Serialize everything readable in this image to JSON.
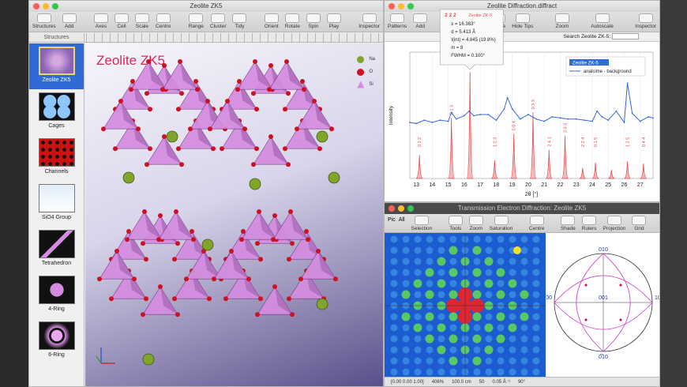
{
  "structure_window": {
    "title": "Zeolite ZK5",
    "toolbar": [
      "Structures",
      "Add",
      "Axes",
      "Cell",
      "Scale",
      "Centre",
      "Range",
      "Cluster",
      "Tidy",
      "Orient",
      "Rotate",
      "Spin",
      "Play",
      "Inspector"
    ],
    "panel_label": "Structures",
    "sidebar": [
      "Zeolite ZK5",
      "Cages",
      "Channels",
      "SiO4 Group",
      "Tetrahedron",
      "4-Ring",
      "6-Ring"
    ],
    "canvas_title": "Zeolite ZK5",
    "legend": [
      {
        "label": "Na",
        "color": "#7fa52a"
      },
      {
        "label": "O",
        "color": "#cc1122"
      },
      {
        "label": "Si",
        "color": "#d58ce0"
      }
    ]
  },
  "diffraction_window": {
    "title": "Zeolite Diffraction.diffract",
    "toolbar": [
      "Patterns",
      "Add",
      "Cursor",
      "Ruler",
      "Loupe",
      "Hide Tips",
      "Zoom",
      "Autoscale",
      "Inspector"
    ],
    "search_label": "Search Zeolite ZK-5:",
    "tooltip": {
      "hkl": "2 2 2",
      "name": "Zeolite ZK-5",
      "lines": [
        "x = 16.363°",
        "d = 5.413 Å",
        "I(int) = 4.845 (19.8%)",
        "m = 8",
        "FWHM = 0.100°"
      ]
    }
  },
  "tem_window": {
    "title": "Transmission Electron Diffraction: Zeolite ZK5",
    "tabs": [
      "Pic",
      "All"
    ],
    "toolbar": [
      "Selection",
      "Tools",
      "Zoom",
      "Saturation",
      "Centre",
      "Shade",
      "Rulers",
      "Projection",
      "Grid"
    ],
    "status": [
      "[0.00 0.00 1.00]",
      "406%",
      "100.0 cm",
      "50",
      "0.05 Å⁻¹",
      "90°"
    ],
    "stereo_labels": [
      "010",
      "0̅10",
      "1̅00",
      "100",
      "001"
    ]
  },
  "chart_data": {
    "type": "line",
    "title": "",
    "xlabel": "2θ [°]",
    "ylabel": "Intensity",
    "xlim": [
      12.6,
      27.8
    ],
    "x_ticks": [
      13,
      14,
      15,
      16,
      17,
      18,
      19,
      20,
      21,
      22,
      23,
      24,
      25,
      26,
      27
    ],
    "series": [
      {
        "name": "Zeolite ZK-5",
        "color": "#e34a4a",
        "type": "peaks",
        "peaks": [
          {
            "x": 13.2,
            "h": 0.22,
            "label": "0 2 2"
          },
          {
            "x": 15.2,
            "h": 0.57,
            "label": "0 1 3"
          },
          {
            "x": 16.36,
            "h": 1.0,
            "label": "2 2 2"
          },
          {
            "x": 17.9,
            "h": 0.17,
            "label": "1 2 3"
          },
          {
            "x": 19.1,
            "h": 0.42,
            "label": "0 0 4"
          },
          {
            "x": 20.3,
            "h": 0.62,
            "label": "0 3 3"
          },
          {
            "x": 21.3,
            "h": 0.27,
            "label": "2 4 1"
          },
          {
            "x": 22.3,
            "h": 0.4,
            "label": "2 3 3"
          },
          {
            "x": 23.4,
            "h": 0.1,
            "label": "2 2 4"
          },
          {
            "x": 24.2,
            "h": 0.15,
            "label": "0 1 5"
          },
          {
            "x": 25.2,
            "h": 0.08,
            "label": ""
          },
          {
            "x": 26.2,
            "h": 0.16,
            "label": "1 2 5"
          },
          {
            "x": 27.2,
            "h": 0.14,
            "label": "0 4 4"
          }
        ]
      },
      {
        "name": "analcime - background",
        "color": "#3a66d8",
        "type": "line",
        "x": [
          12.6,
          13.0,
          13.5,
          14.0,
          14.5,
          15.0,
          15.2,
          15.5,
          16.0,
          16.3,
          16.6,
          17.0,
          17.5,
          18.0,
          18.5,
          18.7,
          19.0,
          19.5,
          20.0,
          20.5,
          21.0,
          21.5,
          22.0,
          22.5,
          23.0,
          23.5,
          24.0,
          24.3,
          24.6,
          25.0,
          25.5,
          26.0,
          26.2,
          26.5,
          27.0,
          27.5,
          27.8
        ],
        "y": [
          0.5,
          0.49,
          0.52,
          0.5,
          0.52,
          0.51,
          0.59,
          0.53,
          0.56,
          0.6,
          0.56,
          0.57,
          0.57,
          0.52,
          0.62,
          0.72,
          0.62,
          0.53,
          0.57,
          0.53,
          0.51,
          0.55,
          0.54,
          0.53,
          0.53,
          0.52,
          0.51,
          0.6,
          0.55,
          0.52,
          0.6,
          0.5,
          0.85,
          0.58,
          0.51,
          0.55,
          0.54
        ]
      }
    ],
    "legend_position": "top-right",
    "grid": true
  }
}
